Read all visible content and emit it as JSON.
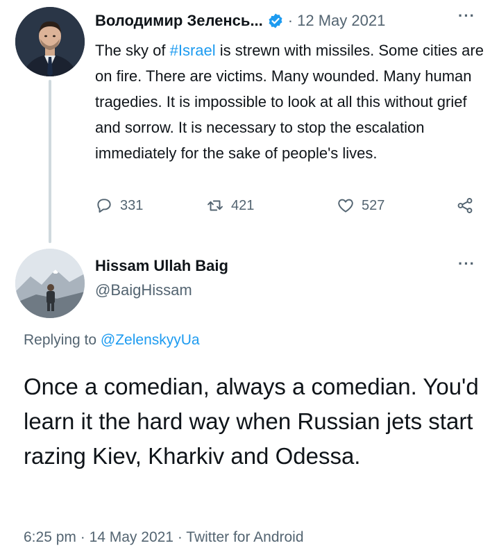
{
  "tweet": {
    "author_name": "Володимир Зеленсь...",
    "separator": "·",
    "date": "12 May 2021",
    "text_before_hashtag": "The sky of ",
    "hashtag": "#Israel",
    "text_after_hashtag": " is strewn with missiles. Some cities are on fire. There are victims. Many wounded. Many human tragedies. It is impossible to look at all this without grief and sorrow. It is necessary to stop the escalation immediately for the sake of people's lives.",
    "more": "···",
    "actions": {
      "replies": "331",
      "retweets": "421",
      "likes": "527"
    }
  },
  "reply": {
    "author_name": "Hissam Ullah Baig",
    "handle": "@BaigHissam",
    "more": "···",
    "replying_prefix": "Replying to ",
    "replying_to": "@ZelenskyyUa",
    "text": "Once a comedian, always a comedian. You'd learn it the hard way when Russian jets start razing Kiev, Kharkiv and Odessa.",
    "time": "6:25 pm",
    "separator": " · ",
    "date": "14 May 2021",
    "source": "Twitter for Android"
  },
  "icons": {
    "verified": "verified-badge-icon",
    "reply": "reply-bubble-icon",
    "retweet": "retweet-icon",
    "like": "heart-icon",
    "share": "share-icon",
    "more": "more-dots-icon"
  },
  "colors": {
    "accent": "#1d9bf0",
    "text": "#0f1419",
    "secondary": "#536471",
    "thread_line": "#cfd9de"
  }
}
